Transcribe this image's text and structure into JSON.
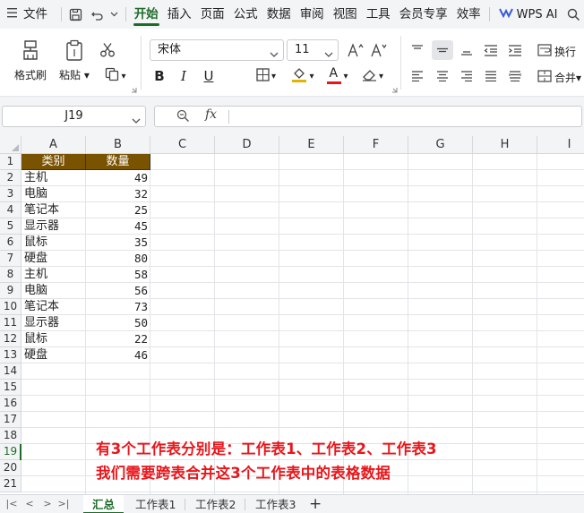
{
  "menu": {
    "file_label": "文件",
    "tabs": [
      "开始",
      "插入",
      "页面",
      "公式",
      "数据",
      "审阅",
      "视图",
      "工具",
      "会员专享",
      "效率"
    ],
    "active_tab": "开始",
    "ai_label": "WPS AI"
  },
  "ribbon": {
    "format_painter": "格式刷",
    "paste": "粘贴",
    "font_name": "宋体",
    "font_size": "11",
    "bold": "B",
    "italic": "I",
    "underline": "U",
    "font_color_letter": "A",
    "fill_accent": "#e0b400",
    "font_color_accent": "#e8161b",
    "wrap_text": "换行",
    "merge": "合并"
  },
  "formula_bar": {
    "cell_ref": "J19",
    "fx_label": "fx",
    "formula": ""
  },
  "grid": {
    "columns": [
      "A",
      "B",
      "C",
      "D",
      "E",
      "F",
      "G",
      "H",
      "I"
    ],
    "rows": [
      "1",
      "2",
      "3",
      "4",
      "5",
      "6",
      "7",
      "8",
      "9",
      "10",
      "11",
      "12",
      "13",
      "14",
      "15",
      "16",
      "17",
      "18",
      "19",
      "20",
      "21"
    ],
    "selected_row": "19",
    "header": {
      "a": "类别",
      "b": "数量"
    },
    "header_fill": "#7a5300",
    "data": [
      {
        "a": "主机",
        "b": "49"
      },
      {
        "a": "电脑",
        "b": "32"
      },
      {
        "a": "笔记本",
        "b": "25"
      },
      {
        "a": "显示器",
        "b": "45"
      },
      {
        "a": "鼠标",
        "b": "35"
      },
      {
        "a": "硬盘",
        "b": "80"
      },
      {
        "a": "主机",
        "b": "58"
      },
      {
        "a": "电脑",
        "b": "56"
      },
      {
        "a": "笔记本",
        "b": "73"
      },
      {
        "a": "显示器",
        "b": "50"
      },
      {
        "a": "鼠标",
        "b": "22"
      },
      {
        "a": "硬盘",
        "b": "46"
      }
    ]
  },
  "annotation": {
    "line1": "有3个工作表分别是：工作表1、工作表2、工作表3",
    "line2": "我们需要跨表合并这3个工作表中的表格数据",
    "color": "#e8161b"
  },
  "sheets": {
    "tabs": [
      "汇总",
      "工作表1",
      "工作表2",
      "工作表3"
    ],
    "active": "汇总",
    "add_label": "+",
    "nav": [
      "|<",
      "<",
      ">",
      ">|"
    ]
  },
  "accent": "#1d6b2a"
}
